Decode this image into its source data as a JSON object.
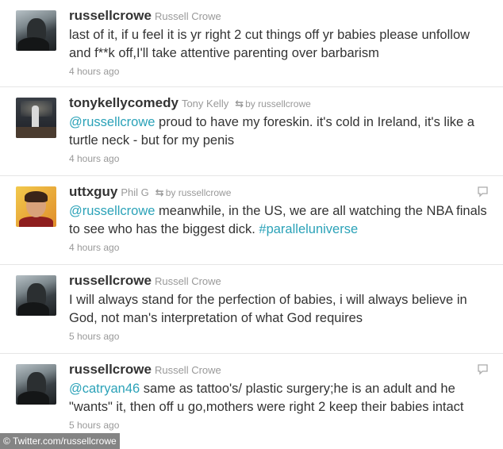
{
  "tweets": [
    {
      "screen_name": "russellcrowe",
      "full_name": "Russell Crowe",
      "retweet": false,
      "retweet_by": "",
      "segments": [
        {
          "type": "text",
          "value": "last of it, if u feel it is yr right 2 cut things off yr babies please unfollow and f**k off,I'll take attentive parenting over barbarism"
        }
      ],
      "time": "4 hours ago",
      "avatar": "russellcrowe-avatar",
      "reply_icon": false
    },
    {
      "screen_name": "tonykellycomedy",
      "full_name": "Tony Kelly",
      "retweet": true,
      "retweet_by": "by russellcrowe",
      "segments": [
        {
          "type": "mention",
          "value": "@russellcrowe"
        },
        {
          "type": "text",
          "value": " proud to have my foreskin. it's cold in Ireland, it's like a turtle neck - but for my penis"
        }
      ],
      "time": "4 hours ago",
      "avatar": "tonykellycomedy-avatar",
      "reply_icon": false
    },
    {
      "screen_name": "uttxguy",
      "full_name": "Phil G",
      "retweet": true,
      "retweet_by": "by russellcrowe",
      "segments": [
        {
          "type": "mention",
          "value": "@russellcrowe"
        },
        {
          "type": "text",
          "value": " meanwhile, in the US, we are all watching the NBA finals to see who has the biggest dick. "
        },
        {
          "type": "hashtag",
          "value": "#paralleluniverse"
        }
      ],
      "time": "4 hours ago",
      "avatar": "uttxguy-avatar",
      "reply_icon": true
    },
    {
      "screen_name": "russellcrowe",
      "full_name": "Russell Crowe",
      "retweet": false,
      "retweet_by": "",
      "segments": [
        {
          "type": "text",
          "value": "I will always stand for the perfection of babies, i will always believe in God, not man's interpretation of what God requires"
        }
      ],
      "time": "5 hours ago",
      "avatar": "russellcrowe-avatar",
      "reply_icon": false
    },
    {
      "screen_name": "russellcrowe",
      "full_name": "Russell Crowe",
      "retweet": false,
      "retweet_by": "",
      "segments": [
        {
          "type": "mention",
          "value": "@catryan46"
        },
        {
          "type": "text",
          "value": " same as tattoo's/ plastic surgery;he is an adult and he \"wants\" it, then off u go,mothers were right 2 keep their babies intact"
        }
      ],
      "time": "5 hours ago",
      "avatar": "russellcrowe-avatar",
      "reply_icon": true
    }
  ],
  "retweet_glyph": "⇆",
  "watermark": "© Twitter.com/russellcrowe",
  "colors": {
    "link": "#2ba2b8",
    "muted": "#999999",
    "text": "#333333"
  }
}
